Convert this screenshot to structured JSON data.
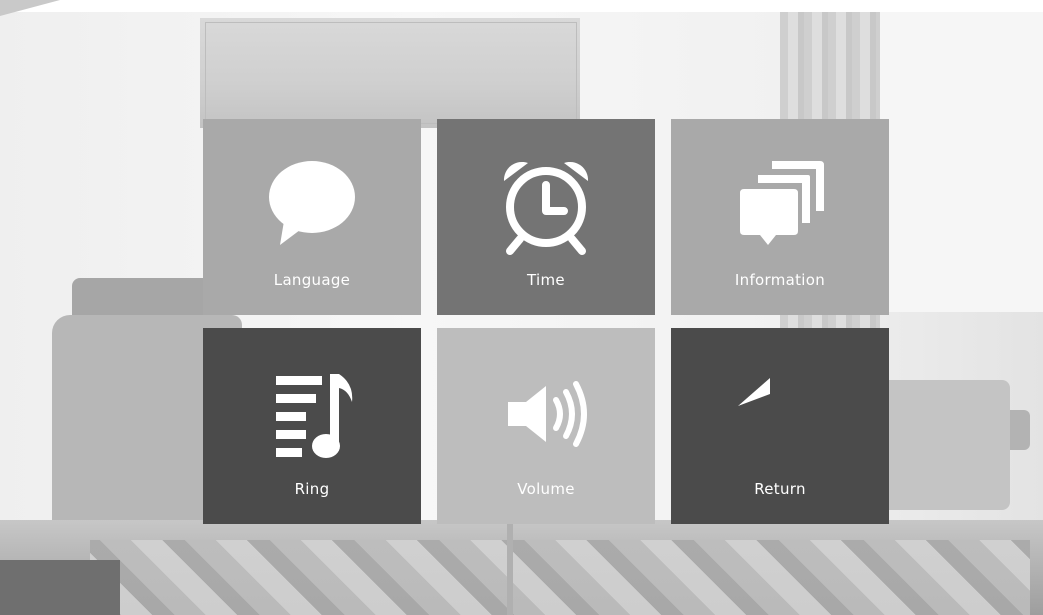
{
  "menu": {
    "language": {
      "label": "Language",
      "icon": "speech-bubble-icon",
      "color": "#a9a9a9"
    },
    "time": {
      "label": "Time",
      "icon": "alarm-clock-icon",
      "color": "#747474"
    },
    "information": {
      "label": "Information",
      "icon": "stacked-messages-icon",
      "color": "#a9a9a9"
    },
    "ring": {
      "label": "Ring",
      "icon": "ringtone-note-icon",
      "color": "#4b4b4b"
    },
    "volume": {
      "label": "Volume",
      "icon": "speaker-icon",
      "color": "#bdbdbd"
    },
    "return": {
      "label": "Return",
      "icon": "return-arrow-icon",
      "color": "#4b4b4b"
    }
  }
}
